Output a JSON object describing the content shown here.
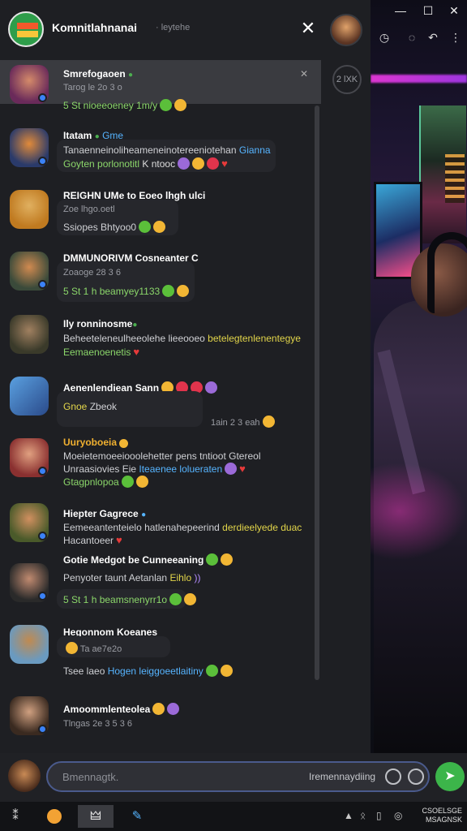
{
  "header": {
    "title": "Komnitlahnanai",
    "subtitle": "·  leytehe",
    "close_icon": "close-icon"
  },
  "pinned": {
    "badge": "2 lXK",
    "pin_icon": "pin-icon"
  },
  "window_controls": [
    "—",
    "☐",
    "✕"
  ],
  "toolbar_icons": [
    "clock-icon",
    "chat-icon",
    "reply-icon",
    "more-icon"
  ],
  "messages": [
    {
      "name": "Smrefogaoen",
      "meta": "Tarog le 2o 3 o",
      "text": "5 St nioeeoeney 1m/y"
    },
    {
      "name": "Itatam",
      "tag": "Gme",
      "text": "Tanaenneinoliheameneinotereeniotehan",
      "text_hl": "Gianna",
      "text2": "Goyten porlonotitl",
      "text2b": "K ntooc"
    },
    {
      "name": "REIGHN UMe to Eoeo lhgh ulci",
      "meta": "Zoe lhgo.oetl",
      "text": "Ssiopes Bhtyoo0"
    },
    {
      "name": "DMMUNORIVM Cosneanter C",
      "meta": "Zoaoge 28 3 6",
      "text": "5 St 1 h beamyey1133"
    },
    {
      "name": "Ily ronninosme",
      "text": "Beheeteleneulheeolehe lieeooeo",
      "text_yl": "betelegtenlenentegye",
      "text2": "Eemaenoenetis"
    },
    {
      "name": "Aenenlendiean Sann",
      "text": "Gnoe",
      "text_b": "Zbeok",
      "meta": "1ain 2 3 eah"
    },
    {
      "name": "Uuryoboeia",
      "text": "Moeietemoeeiooolehetter pens tntioot Gtereol",
      "text2": "Unraasiovies Eie",
      "text2_hl": "Iteaenee lolueraten",
      "text3": "Gtagpnlopoa"
    },
    {
      "name": "Hiepter Gagrece",
      "text": "Eemeeantenteielo hatlenahepeerind",
      "text_yl": "derdieelyede duac",
      "text2": "Hacantoeer"
    },
    {
      "name": "Gotie Medgot be Cunneeaning",
      "text": "Penyoter taunt Aetanlan",
      "text_yl": "Eihlo",
      "text3": "5 St 1 h beamsnenyrr1o"
    },
    {
      "name": "Hegonnom Koeanes",
      "meta": "Ta ae7e2o",
      "text": "Tsee laeo",
      "text_hl": "Hogen leiggoeetlaitiny"
    },
    {
      "name": "Amoommlenteolea",
      "meta": "Tlngas 2e 3 5 3 6"
    }
  ],
  "input": {
    "placeholder": "Bmennagtk.",
    "right_text": "Iremennaydiing",
    "send_icon": "send-icon"
  },
  "taskbar": {
    "clock_line1": "CSOELSGE",
    "clock_line2": "MSAGNSK"
  }
}
